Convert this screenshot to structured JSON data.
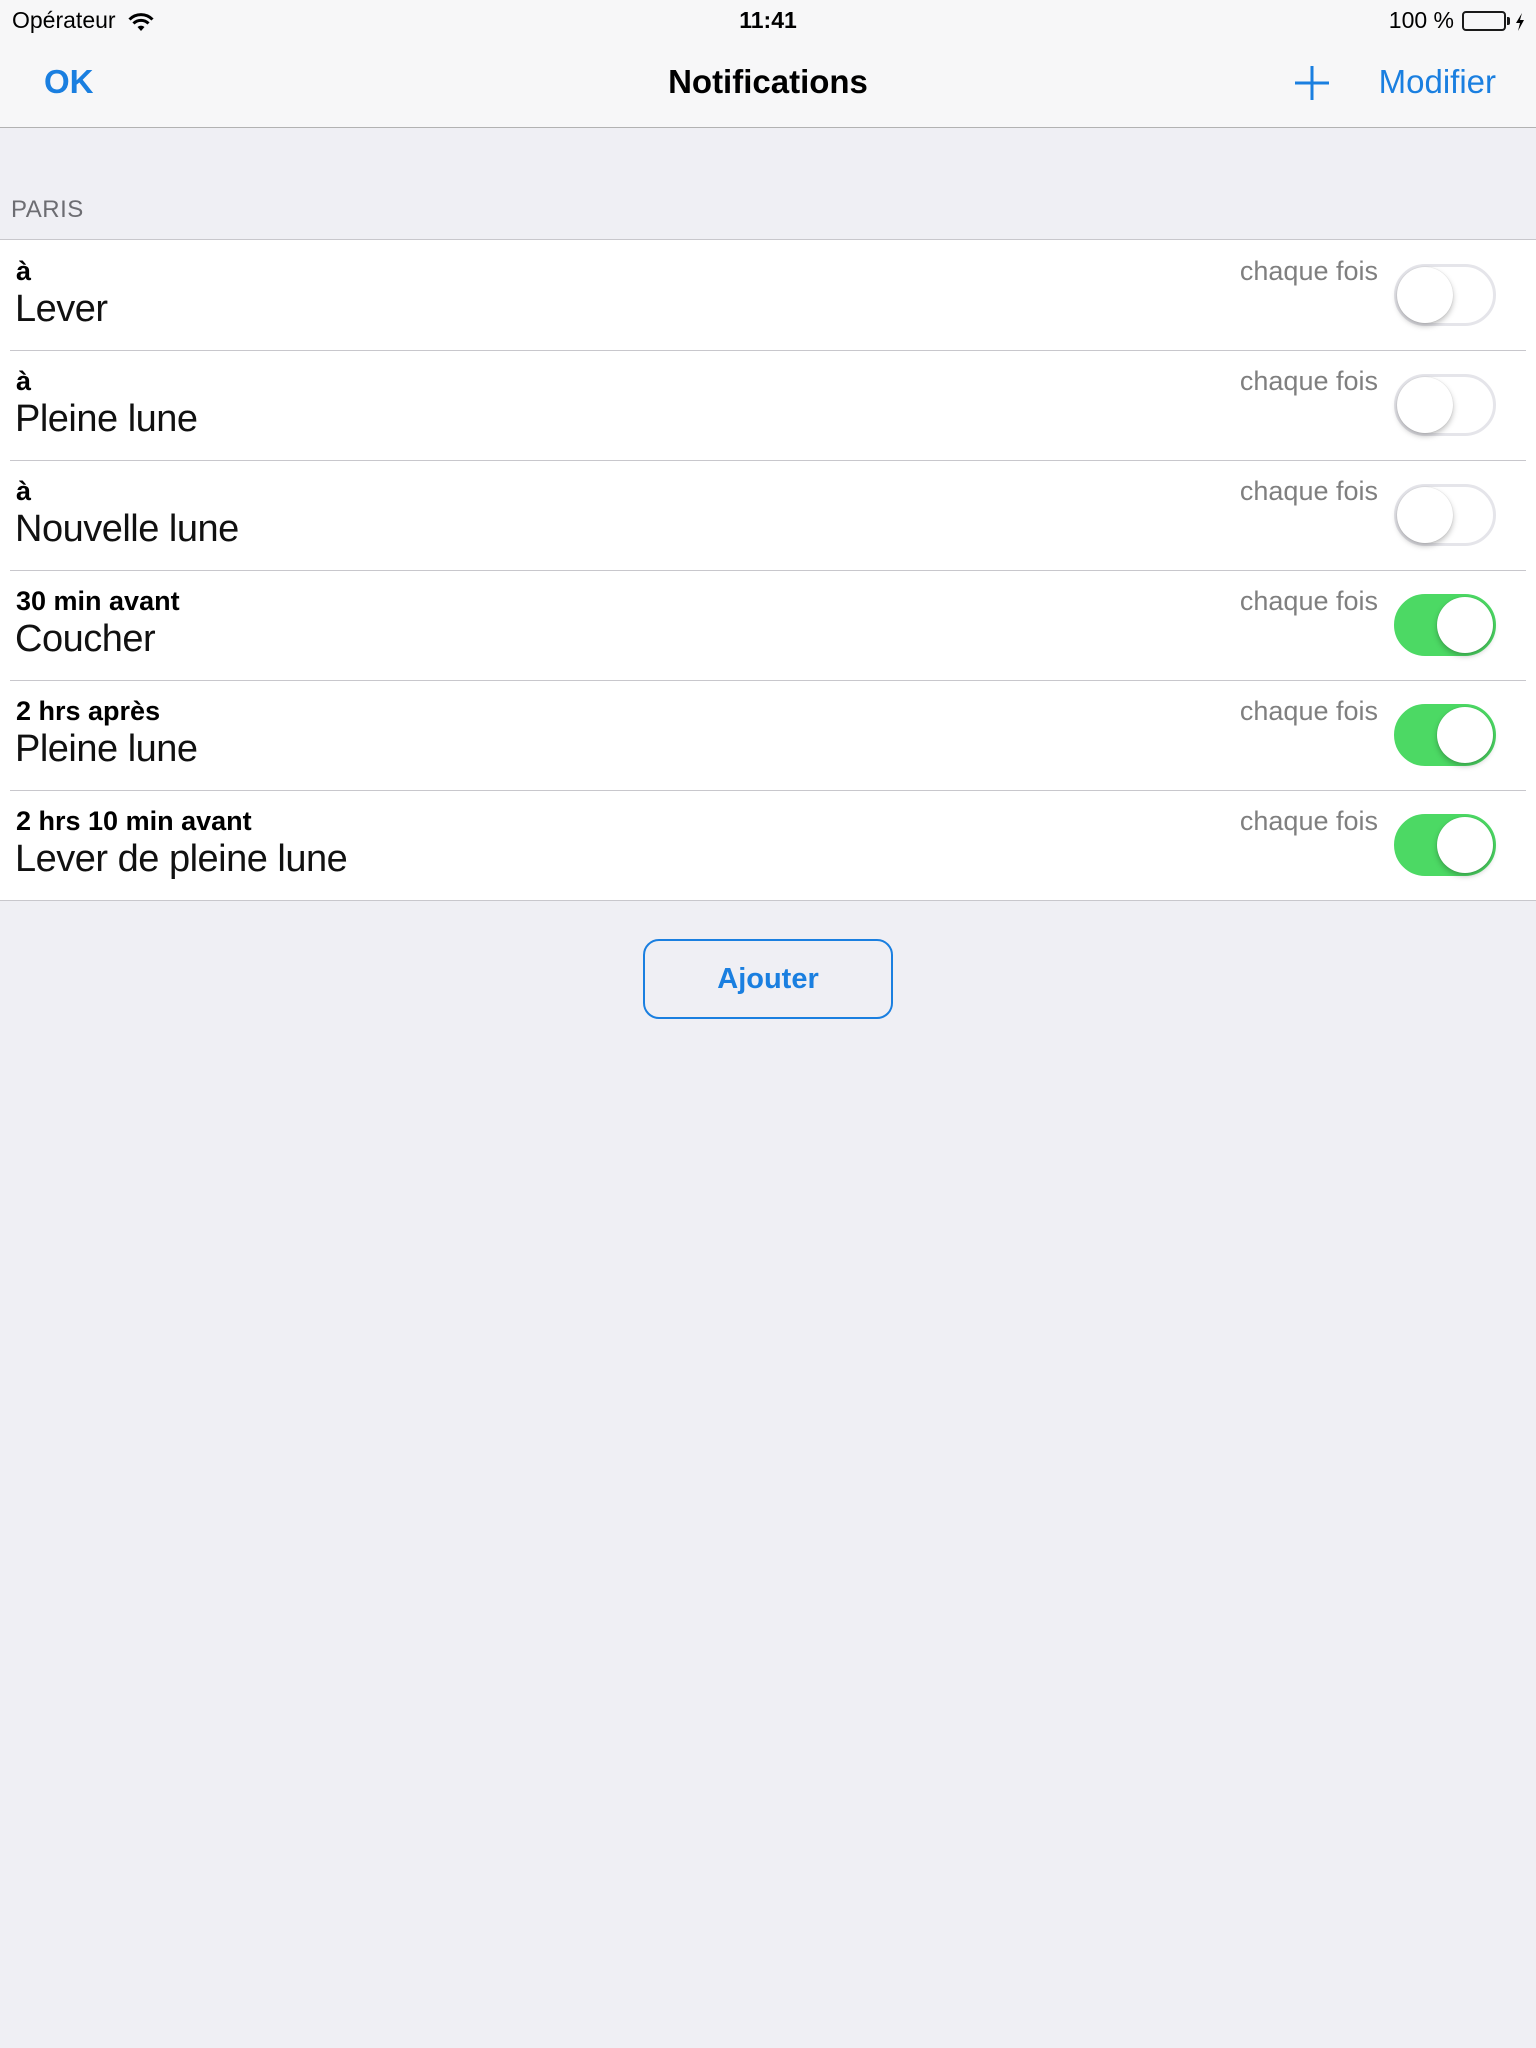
{
  "status_bar": {
    "carrier": "Opérateur",
    "wifi_icon": "wifi-icon",
    "time": "11:41",
    "battery_percent_label": "100 %",
    "battery_level": 1.0,
    "battery_icon": "battery-icon",
    "charging_icon": "bolt-icon"
  },
  "nav_bar": {
    "left_button": "OK",
    "title": "Notifications",
    "add_icon": "plus-icon",
    "right_button": "Modifier"
  },
  "section": {
    "header": "PARIS",
    "rows": [
      {
        "offset": "à",
        "event": "Lever",
        "repeat": "chaque fois",
        "enabled": false
      },
      {
        "offset": "à",
        "event": "Pleine lune",
        "repeat": "chaque fois",
        "enabled": false
      },
      {
        "offset": "à",
        "event": "Nouvelle lune",
        "repeat": "chaque fois",
        "enabled": false
      },
      {
        "offset": "30 min avant",
        "event": "Coucher",
        "repeat": "chaque fois",
        "enabled": true
      },
      {
        "offset": "2 hrs  après",
        "event": "Pleine lune",
        "repeat": "chaque fois",
        "enabled": true
      },
      {
        "offset": "2 hrs  10 min avant",
        "event": "Lever de pleine lune",
        "repeat": "chaque fois",
        "enabled": true
      }
    ]
  },
  "add_button": "Ajouter",
  "colors": {
    "accent": "#1a7fe0",
    "toggle_on": "#4cd964",
    "background": "#efeff4",
    "section_header_text": "#6d6d72",
    "secondary_text": "#7f7f7f"
  }
}
